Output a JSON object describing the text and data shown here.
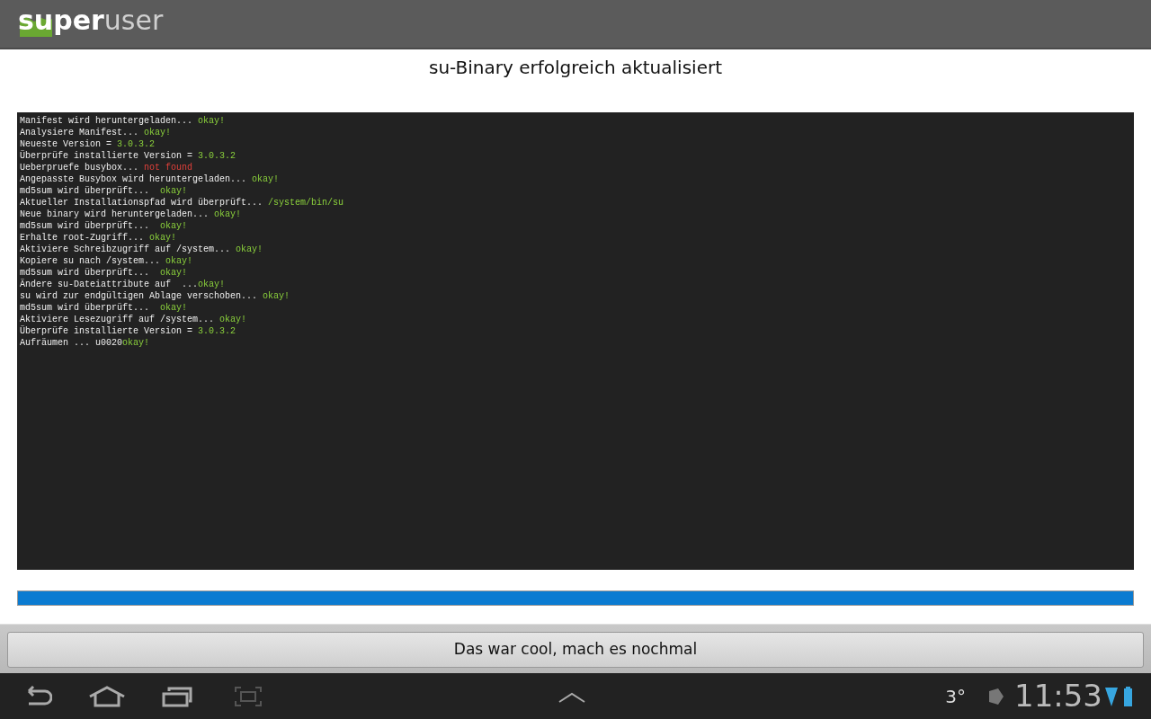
{
  "app_bar": {
    "logo_bold": "super",
    "logo_light": "user"
  },
  "title": "su-Binary erfolgreich aktualisiert",
  "log": [
    {
      "text": "Manifest wird heruntergeladen... ",
      "result": "okay!",
      "kind": "ok"
    },
    {
      "text": "Analysiere Manifest... ",
      "result": "okay!",
      "kind": "ok"
    },
    {
      "text": "Neueste Version = ",
      "result": "3.0.3.2",
      "kind": "ok"
    },
    {
      "text": "Überprüfe installierte Version = ",
      "result": "3.0.3.2",
      "kind": "ok"
    },
    {
      "text": "Ueberpruefe busybox... ",
      "result": "not found",
      "kind": "error"
    },
    {
      "text": "Angepasste Busybox wird heruntergeladen... ",
      "result": "okay!",
      "kind": "ok"
    },
    {
      "text": "md5sum wird überprüft...  ",
      "result": "okay!",
      "kind": "ok"
    },
    {
      "text": "Aktueller Installationspfad wird überprüft... ",
      "result": "/system/bin/su",
      "kind": "ok"
    },
    {
      "text": "Neue binary wird heruntergeladen... ",
      "result": "okay!",
      "kind": "ok"
    },
    {
      "text": "md5sum wird überprüft...  ",
      "result": "okay!",
      "kind": "ok"
    },
    {
      "text": "Erhalte root-Zugriff... ",
      "result": "okay!",
      "kind": "ok"
    },
    {
      "text": "Aktiviere Schreibzugriff auf /system... ",
      "result": "okay!",
      "kind": "ok"
    },
    {
      "text": "Kopiere su nach /system... ",
      "result": "okay!",
      "kind": "ok"
    },
    {
      "text": "md5sum wird überprüft...  ",
      "result": "okay!",
      "kind": "ok"
    },
    {
      "text": "Ändere su-Dateiattribute auf  ...",
      "result": "okay!",
      "kind": "ok"
    },
    {
      "text": "su wird zur endgültigen Ablage verschoben... ",
      "result": "okay!",
      "kind": "ok"
    },
    {
      "text": "md5sum wird überprüft...  ",
      "result": "okay!",
      "kind": "ok"
    },
    {
      "text": "Aktiviere Lesezugriff auf /system... ",
      "result": "okay!",
      "kind": "ok"
    },
    {
      "text": "Überprüfe installierte Version = ",
      "result": "3.0.3.2",
      "kind": "ok"
    },
    {
      "text": "Aufräumen ... u0020",
      "result": "okay!",
      "kind": "ok"
    }
  ],
  "progress": {
    "level": 1
  },
  "button": "Das war cool, mach es nochmal",
  "status_bar": {
    "temperature": "3°",
    "time": "11:53"
  }
}
